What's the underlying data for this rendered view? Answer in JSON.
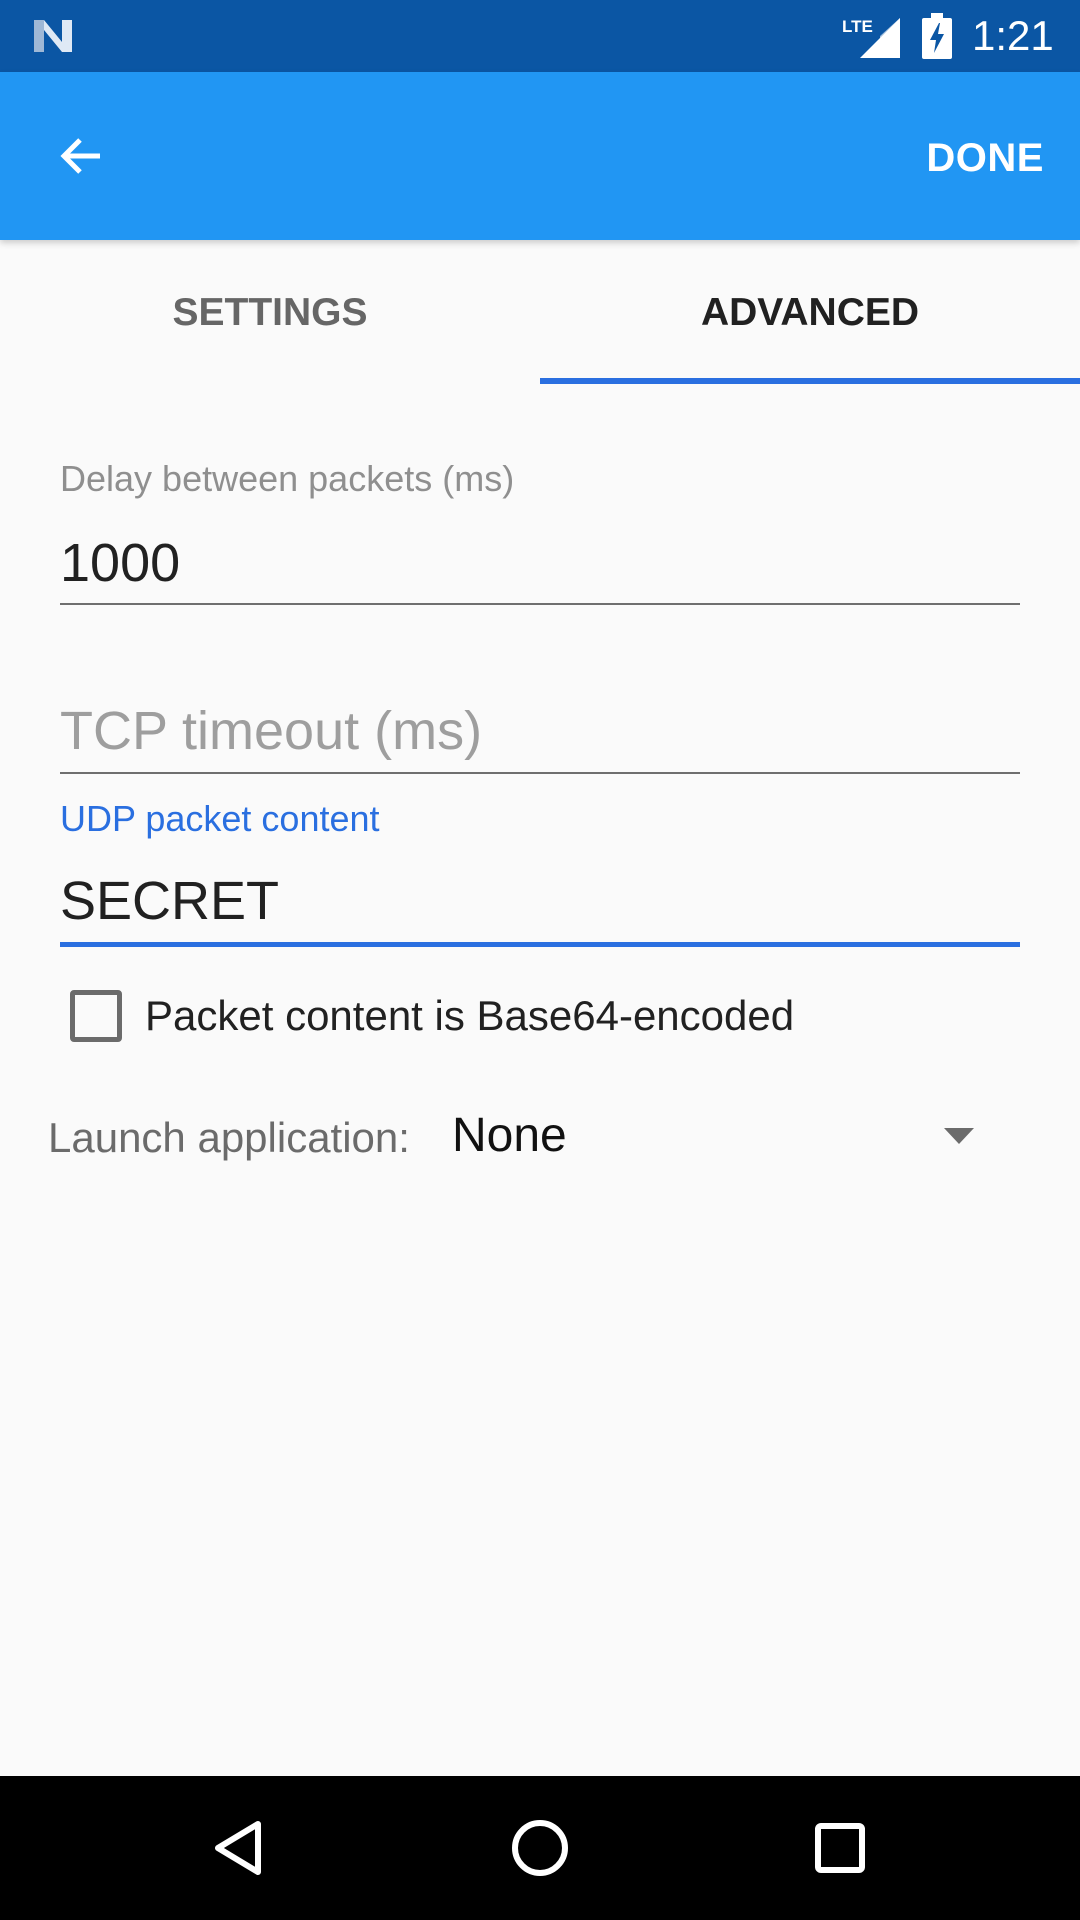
{
  "status_bar": {
    "time": "1:21",
    "network_label": "LTE",
    "icons": [
      "notification-n-icon",
      "lte-signal-icon",
      "battery-charging-icon"
    ]
  },
  "app_bar": {
    "back_icon": "arrow-back-icon",
    "done_label": "DONE"
  },
  "tabs": [
    {
      "label": "SETTINGS",
      "selected": false
    },
    {
      "label": "ADVANCED",
      "selected": true
    }
  ],
  "fields": {
    "delay": {
      "label": "Delay between packets (ms)",
      "value": "1000"
    },
    "tcp_timeout": {
      "placeholder": "TCP timeout (ms)",
      "value": ""
    },
    "udp_content": {
      "label": "UDP packet content",
      "value": "SECRET"
    }
  },
  "checkbox": {
    "label": "Packet content is Base64-encoded",
    "checked": false
  },
  "launch": {
    "label": "Launch application:",
    "value": "None"
  },
  "nav_bar": {
    "icons": [
      "nav-back-icon",
      "nav-home-icon",
      "nav-recents-icon"
    ]
  },
  "colors": {
    "status_bar": "#0b56a4",
    "app_bar": "#2196f3",
    "accent": "#2a6fe0",
    "background": "#fafafa"
  }
}
